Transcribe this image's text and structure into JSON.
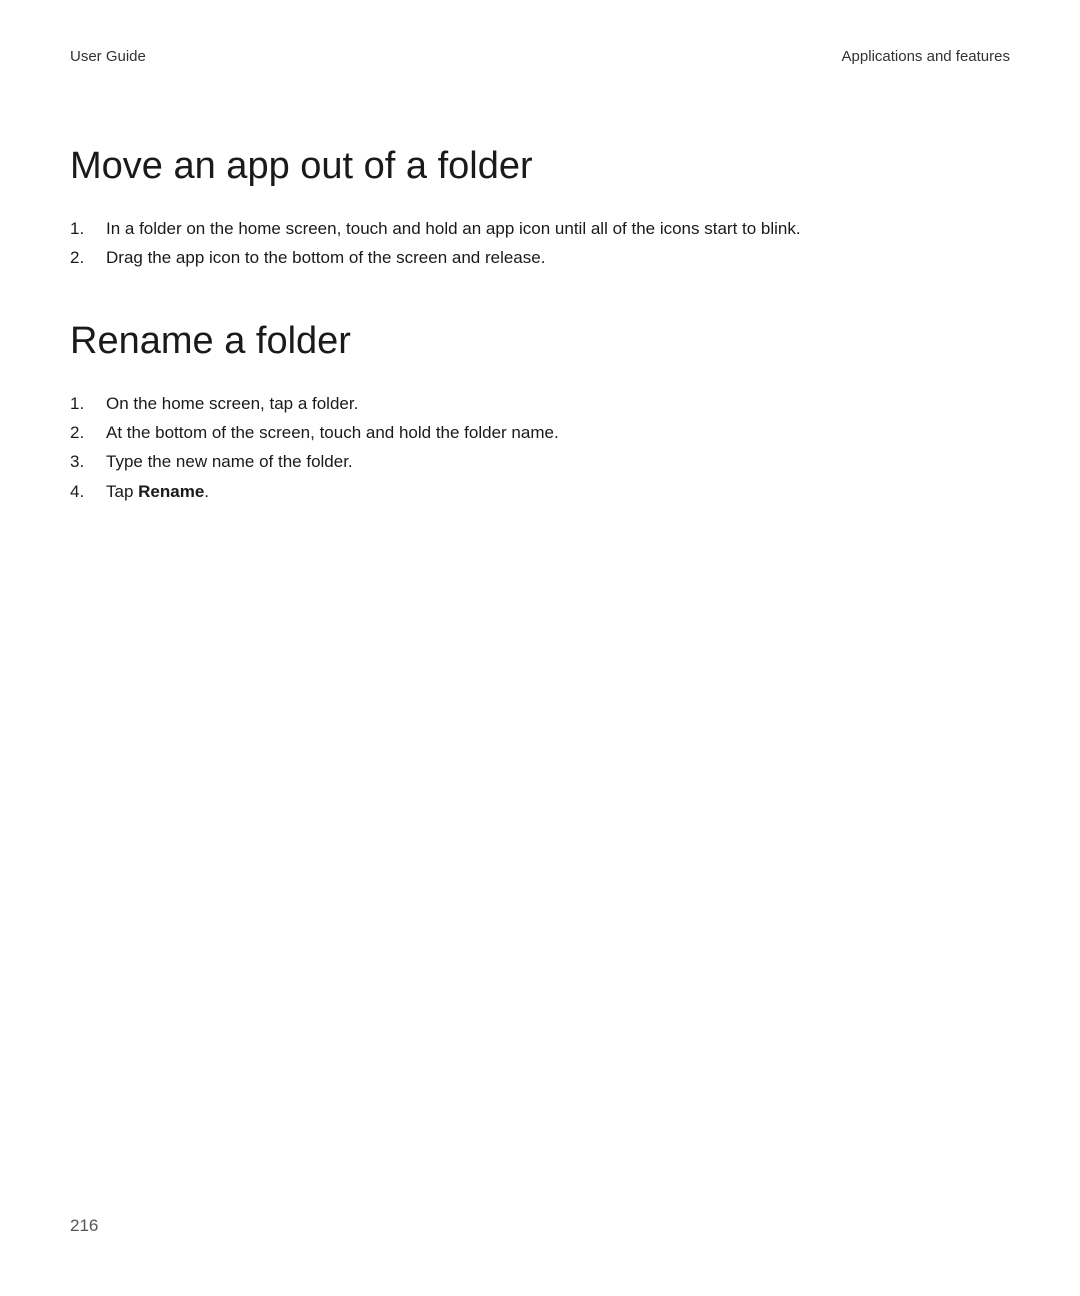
{
  "header": {
    "left": "User Guide",
    "right": "Applications and features"
  },
  "sections": [
    {
      "heading": "Move an app out of a folder",
      "items": [
        {
          "num": "1.",
          "text": "In a folder on the home screen, touch and hold an app icon until all of the icons start to blink."
        },
        {
          "num": "2.",
          "text": "Drag the app icon to the bottom of the screen and release."
        }
      ]
    },
    {
      "heading": "Rename a folder",
      "items": [
        {
          "num": "1.",
          "text": "On the home screen, tap a folder."
        },
        {
          "num": "2.",
          "text": "At the bottom of the screen, touch and hold the folder name."
        },
        {
          "num": "3.",
          "text": "Type the new name of the folder."
        },
        {
          "num": "4.",
          "prefix": "Tap ",
          "bold": "Rename",
          "suffix": "."
        }
      ]
    }
  ],
  "pageNumber": "216"
}
